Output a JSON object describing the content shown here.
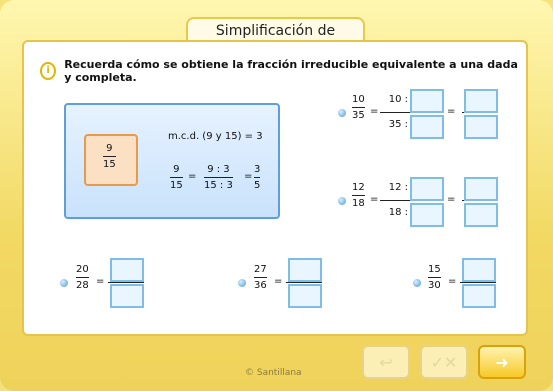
{
  "title": "Simplificación de fracciones",
  "instruction": "Recuerda cómo se obtiene la fracción irreducible equivalente a una dada y completa.",
  "example": {
    "fraction": {
      "num": "9",
      "den": "15"
    },
    "mcd": "m.c.d. (9 y 15) = 3",
    "step1": {
      "num": "9",
      "den": "15"
    },
    "step2": {
      "num": "9 : 3",
      "den": "15 : 3"
    },
    "result": {
      "num": "3",
      "den": "5"
    },
    "eq": "="
  },
  "exercises": {
    "a": {
      "num": "10",
      "den": "35",
      "num_div": "10 :",
      "den_div": "35 :"
    },
    "b": {
      "num": "12",
      "den": "18",
      "num_div": "12 :",
      "den_div": "18 :"
    },
    "c": {
      "num": "20",
      "den": "28"
    },
    "d": {
      "num": "27",
      "den": "36"
    },
    "e": {
      "num": "15",
      "den": "30"
    }
  },
  "eq_sign": "=",
  "footer": "© Santillana",
  "icons": {
    "info": "info-icon",
    "back": "back-arrow-icon",
    "check": "check-icon",
    "next": "next-arrow-icon"
  },
  "colors": {
    "frame": "#f2d964",
    "example_bg": "#c9e2fb",
    "input_border": "#7fbce6",
    "highlight": "#e69a4c"
  }
}
